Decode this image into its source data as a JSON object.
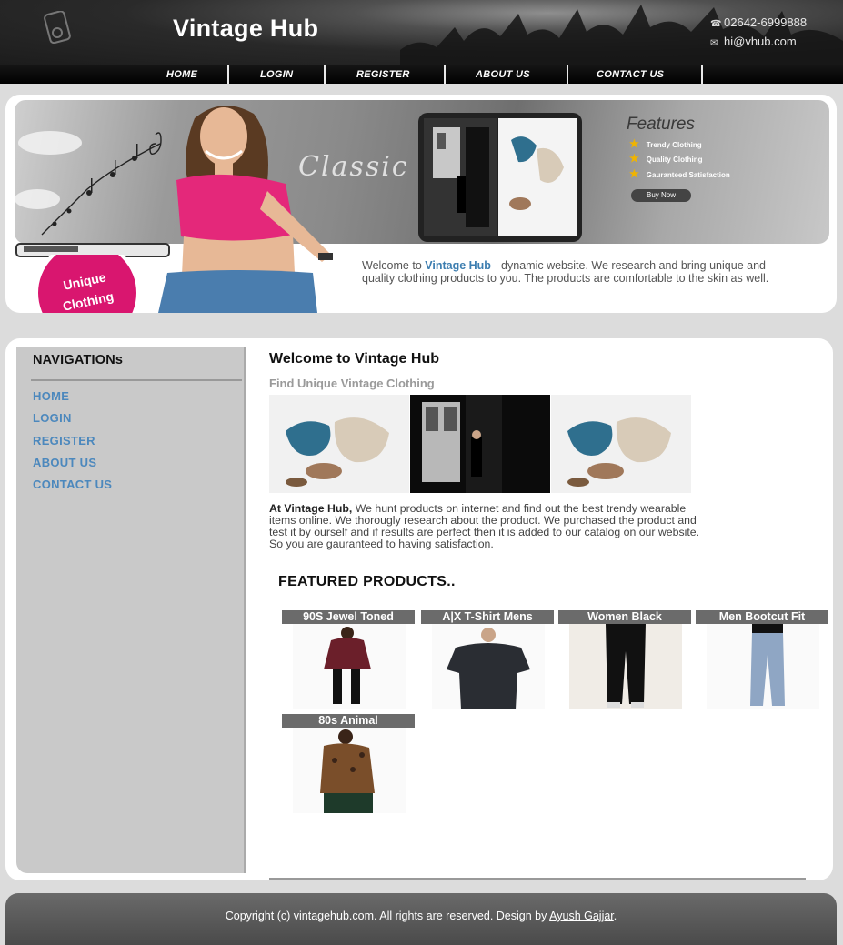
{
  "header": {
    "site_title": "Vintage Hub",
    "phone": "02642-6999888",
    "email": "hi@vhub.com",
    "nav": [
      "HOME",
      "LOGIN",
      "REGISTER",
      "ABOUT US",
      "CONTACT US"
    ]
  },
  "banner": {
    "classic": "Classic",
    "features_title": "Features",
    "features": [
      "Trendy Clothing",
      "Quality Clothing",
      "Gauranteed Satisfaction"
    ],
    "buy_now": "Buy Now",
    "badge_line1": "Unique",
    "badge_line2": "Clothing",
    "intro_pre": "Welcome to ",
    "intro_brand": "Vintage Hub",
    "intro_post": " - dynamic website. We research and bring unique and quality clothing products to you. The products are comfortable to the skin as well."
  },
  "sidebar": {
    "title": "NAVIGATIONs",
    "links": [
      "HOME",
      "LOGIN",
      "REGISTER",
      "ABOUT US",
      "CONTACT US"
    ]
  },
  "main": {
    "welcome_title": "Welcome to Vintage Hub",
    "subtitle": "Find Unique Vintage Clothing",
    "body_bold": "At Vintage Hub,",
    "body_text": " We hunt products on internet and find out the best trendy wearable items online. We thorougly research about the product. We purchased the product and test it by ourself and if results are perfect then it is added to our catalog on our website. So you are gauranteed to having satisfaction.",
    "featured_title": "FEATURED PRODUCTS..",
    "products": [
      "90S Jewel Toned",
      "A|X T-Shirt Mens",
      "Women Black",
      "Men Bootcut Fit",
      "80s Animal"
    ]
  },
  "footer": {
    "copyright_pre": "Copyright (c) vintagehub.com. All rights are reserved. Design by ",
    "author": "Ayush Gajjar",
    "copyright_post": "."
  },
  "colors": {
    "accent_link": "#4c88bd",
    "badge": "#d9166f",
    "star": "#f0b400"
  },
  "icons": [
    "phone-icon",
    "mail-icon",
    "star-icon"
  ]
}
